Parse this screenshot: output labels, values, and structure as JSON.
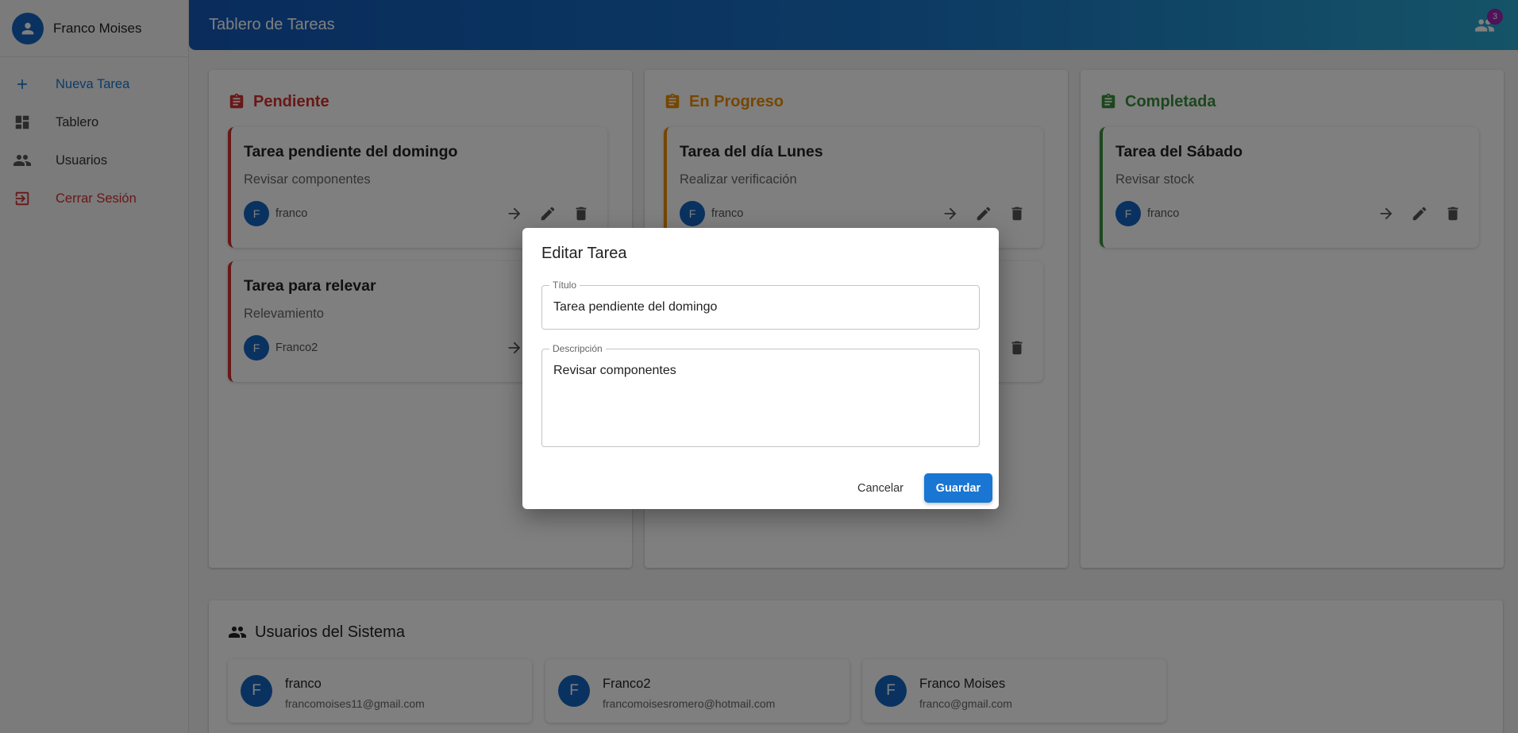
{
  "sidebar": {
    "user_name": "Franco Moises",
    "items": [
      {
        "label": "Nueva Tarea",
        "icon": "plus-icon"
      },
      {
        "label": "Tablero",
        "icon": "dashboard-icon"
      },
      {
        "label": "Usuarios",
        "icon": "users-icon"
      },
      {
        "label": "Cerrar Sesión",
        "icon": "logout-icon"
      }
    ]
  },
  "header": {
    "title": "Tablero de Tareas",
    "users_badge": "3"
  },
  "columns": [
    {
      "title": "Pendiente",
      "color": "#d32f2f",
      "tasks": [
        {
          "title": "Tarea pendiente del domingo",
          "description": "Revisar componentes",
          "avatar": "F",
          "user": "franco"
        },
        {
          "title": "Tarea para relevar",
          "description": "Relevamiento",
          "avatar": "F",
          "user": "Franco2"
        }
      ]
    },
    {
      "title": "En Progreso",
      "color": "#ed8c00",
      "tasks": [
        {
          "title": "Tarea del día Lunes",
          "description": "Realizar verificación",
          "avatar": "F",
          "user": "franco"
        }
      ]
    },
    {
      "title": "Completada",
      "color": "#388e3c",
      "tasks": [
        {
          "title": "Tarea del Sábado",
          "description": "Revisar stock",
          "avatar": "F",
          "user": "franco"
        }
      ]
    }
  ],
  "users_section": {
    "title": "Usuarios del Sistema",
    "users": [
      {
        "avatar": "F",
        "name": "franco",
        "email": "francomoises11@gmail.com"
      },
      {
        "avatar": "F",
        "name": "Franco2",
        "email": "francomoisesromero@hotmail.com"
      },
      {
        "avatar": "F",
        "name": "Franco Moises",
        "email": "franco@gmail.com"
      }
    ]
  },
  "dialog": {
    "title": "Editar Tarea",
    "title_label": "Título",
    "title_value": "Tarea pendiente del domingo",
    "description_label": "Descripción",
    "description_value": "Revisar componentes",
    "cancel_label": "Cancelar",
    "save_label": "Guardar"
  },
  "colors": {
    "primary": "#1976d2",
    "danger": "#d32f2f",
    "warning": "#ed8c00",
    "success": "#388e3c",
    "badge": "#9c27b0"
  }
}
